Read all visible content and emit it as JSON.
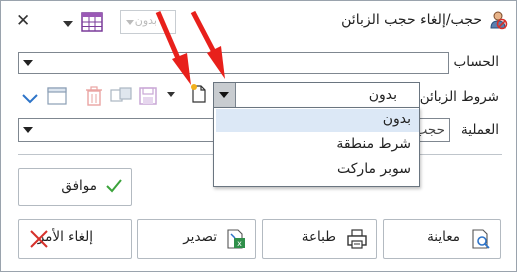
{
  "window": {
    "title": "حجب/إلغاء حجب الزبائن",
    "toolbar_combo_value": "بدون"
  },
  "form": {
    "account_label": "الحساب",
    "account_value": "",
    "conditions_label": "شروط الزبائن",
    "conditions_value": "بدون",
    "operation_label": "العملية",
    "operation_value": "حجب"
  },
  "conditions_dropdown": {
    "options": [
      "بدون",
      "شرط منطقة",
      "سوبر ماركت"
    ],
    "selected_index": 0
  },
  "buttons": {
    "ok": "موافق",
    "preview": "معاينة",
    "print": "طباعة",
    "export": "تصدير",
    "cancel": "إلغاء الأمر"
  },
  "colors": {
    "annotation_arrow": "#e8201b",
    "selection": "#dce8f6",
    "ok_check": "#3ba33b",
    "cancel_x": "#d6312b",
    "export_icon": "#2f8f4a",
    "toolbar_blue": "#2e74c8"
  }
}
